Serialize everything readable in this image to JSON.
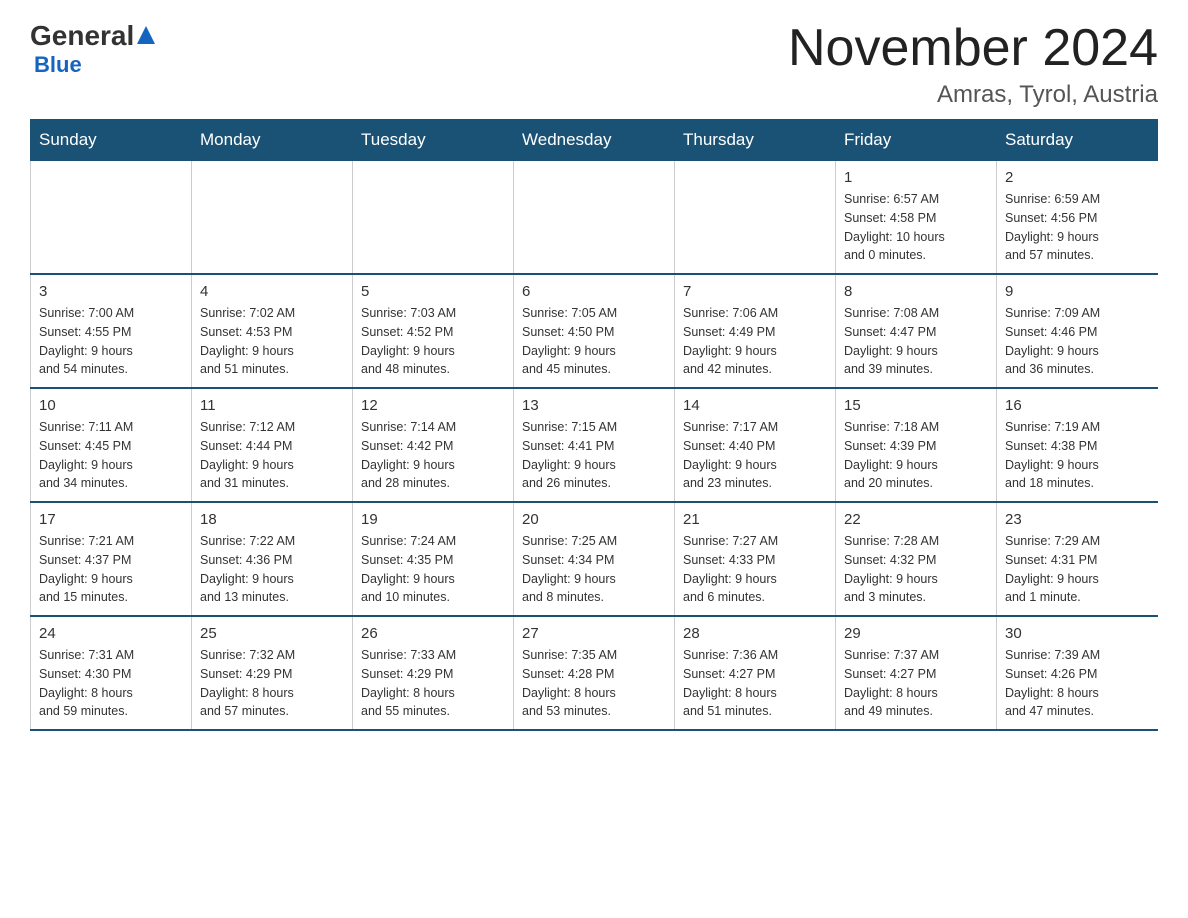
{
  "header": {
    "logo_general": "General",
    "logo_blue": "Blue",
    "month_title": "November 2024",
    "location": "Amras, Tyrol, Austria"
  },
  "weekdays": [
    "Sunday",
    "Monday",
    "Tuesday",
    "Wednesday",
    "Thursday",
    "Friday",
    "Saturday"
  ],
  "weeks": [
    {
      "days": [
        {
          "number": "",
          "info": "",
          "empty": true
        },
        {
          "number": "",
          "info": "",
          "empty": true
        },
        {
          "number": "",
          "info": "",
          "empty": true
        },
        {
          "number": "",
          "info": "",
          "empty": true
        },
        {
          "number": "",
          "info": "",
          "empty": true
        },
        {
          "number": "1",
          "info": "Sunrise: 6:57 AM\nSunset: 4:58 PM\nDaylight: 10 hours\nand 0 minutes.",
          "empty": false
        },
        {
          "number": "2",
          "info": "Sunrise: 6:59 AM\nSunset: 4:56 PM\nDaylight: 9 hours\nand 57 minutes.",
          "empty": false
        }
      ]
    },
    {
      "days": [
        {
          "number": "3",
          "info": "Sunrise: 7:00 AM\nSunset: 4:55 PM\nDaylight: 9 hours\nand 54 minutes.",
          "empty": false
        },
        {
          "number": "4",
          "info": "Sunrise: 7:02 AM\nSunset: 4:53 PM\nDaylight: 9 hours\nand 51 minutes.",
          "empty": false
        },
        {
          "number": "5",
          "info": "Sunrise: 7:03 AM\nSunset: 4:52 PM\nDaylight: 9 hours\nand 48 minutes.",
          "empty": false
        },
        {
          "number": "6",
          "info": "Sunrise: 7:05 AM\nSunset: 4:50 PM\nDaylight: 9 hours\nand 45 minutes.",
          "empty": false
        },
        {
          "number": "7",
          "info": "Sunrise: 7:06 AM\nSunset: 4:49 PM\nDaylight: 9 hours\nand 42 minutes.",
          "empty": false
        },
        {
          "number": "8",
          "info": "Sunrise: 7:08 AM\nSunset: 4:47 PM\nDaylight: 9 hours\nand 39 minutes.",
          "empty": false
        },
        {
          "number": "9",
          "info": "Sunrise: 7:09 AM\nSunset: 4:46 PM\nDaylight: 9 hours\nand 36 minutes.",
          "empty": false
        }
      ]
    },
    {
      "days": [
        {
          "number": "10",
          "info": "Sunrise: 7:11 AM\nSunset: 4:45 PM\nDaylight: 9 hours\nand 34 minutes.",
          "empty": false
        },
        {
          "number": "11",
          "info": "Sunrise: 7:12 AM\nSunset: 4:44 PM\nDaylight: 9 hours\nand 31 minutes.",
          "empty": false
        },
        {
          "number": "12",
          "info": "Sunrise: 7:14 AM\nSunset: 4:42 PM\nDaylight: 9 hours\nand 28 minutes.",
          "empty": false
        },
        {
          "number": "13",
          "info": "Sunrise: 7:15 AM\nSunset: 4:41 PM\nDaylight: 9 hours\nand 26 minutes.",
          "empty": false
        },
        {
          "number": "14",
          "info": "Sunrise: 7:17 AM\nSunset: 4:40 PM\nDaylight: 9 hours\nand 23 minutes.",
          "empty": false
        },
        {
          "number": "15",
          "info": "Sunrise: 7:18 AM\nSunset: 4:39 PM\nDaylight: 9 hours\nand 20 minutes.",
          "empty": false
        },
        {
          "number": "16",
          "info": "Sunrise: 7:19 AM\nSunset: 4:38 PM\nDaylight: 9 hours\nand 18 minutes.",
          "empty": false
        }
      ]
    },
    {
      "days": [
        {
          "number": "17",
          "info": "Sunrise: 7:21 AM\nSunset: 4:37 PM\nDaylight: 9 hours\nand 15 minutes.",
          "empty": false
        },
        {
          "number": "18",
          "info": "Sunrise: 7:22 AM\nSunset: 4:36 PM\nDaylight: 9 hours\nand 13 minutes.",
          "empty": false
        },
        {
          "number": "19",
          "info": "Sunrise: 7:24 AM\nSunset: 4:35 PM\nDaylight: 9 hours\nand 10 minutes.",
          "empty": false
        },
        {
          "number": "20",
          "info": "Sunrise: 7:25 AM\nSunset: 4:34 PM\nDaylight: 9 hours\nand 8 minutes.",
          "empty": false
        },
        {
          "number": "21",
          "info": "Sunrise: 7:27 AM\nSunset: 4:33 PM\nDaylight: 9 hours\nand 6 minutes.",
          "empty": false
        },
        {
          "number": "22",
          "info": "Sunrise: 7:28 AM\nSunset: 4:32 PM\nDaylight: 9 hours\nand 3 minutes.",
          "empty": false
        },
        {
          "number": "23",
          "info": "Sunrise: 7:29 AM\nSunset: 4:31 PM\nDaylight: 9 hours\nand 1 minute.",
          "empty": false
        }
      ]
    },
    {
      "days": [
        {
          "number": "24",
          "info": "Sunrise: 7:31 AM\nSunset: 4:30 PM\nDaylight: 8 hours\nand 59 minutes.",
          "empty": false
        },
        {
          "number": "25",
          "info": "Sunrise: 7:32 AM\nSunset: 4:29 PM\nDaylight: 8 hours\nand 57 minutes.",
          "empty": false
        },
        {
          "number": "26",
          "info": "Sunrise: 7:33 AM\nSunset: 4:29 PM\nDaylight: 8 hours\nand 55 minutes.",
          "empty": false
        },
        {
          "number": "27",
          "info": "Sunrise: 7:35 AM\nSunset: 4:28 PM\nDaylight: 8 hours\nand 53 minutes.",
          "empty": false
        },
        {
          "number": "28",
          "info": "Sunrise: 7:36 AM\nSunset: 4:27 PM\nDaylight: 8 hours\nand 51 minutes.",
          "empty": false
        },
        {
          "number": "29",
          "info": "Sunrise: 7:37 AM\nSunset: 4:27 PM\nDaylight: 8 hours\nand 49 minutes.",
          "empty": false
        },
        {
          "number": "30",
          "info": "Sunrise: 7:39 AM\nSunset: 4:26 PM\nDaylight: 8 hours\nand 47 minutes.",
          "empty": false
        }
      ]
    }
  ]
}
